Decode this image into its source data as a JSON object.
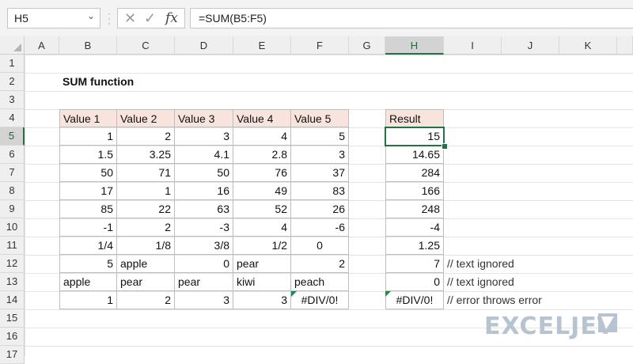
{
  "name_box": "H5",
  "formula": "=SUM(B5:F5)",
  "icons": {
    "cancel": "cancel-icon",
    "enter": "enter-icon",
    "function": "fx-icon",
    "dropdown": "chevron-down-icon"
  },
  "fx_label": "fx",
  "columns": [
    "A",
    "B",
    "C",
    "D",
    "E",
    "F",
    "G",
    "H",
    "I",
    "J",
    "K"
  ],
  "rows": [
    "1",
    "2",
    "3",
    "4",
    "5",
    "6",
    "7",
    "8",
    "9",
    "10",
    "11",
    "12",
    "13",
    "14",
    "15",
    "16",
    "17"
  ],
  "selected_column": "H",
  "selected_row": "5",
  "title": "SUM function",
  "table_headers": [
    "Value 1",
    "Value 2",
    "Value 3",
    "Value 4",
    "Value 5"
  ],
  "table_rows": [
    [
      "1",
      "2",
      "3",
      "4",
      "5"
    ],
    [
      "1.5",
      "3.25",
      "4.1",
      "2.8",
      "3"
    ],
    [
      "50",
      "71",
      "50",
      "76",
      "37"
    ],
    [
      "17",
      "1",
      "16",
      "49",
      "83"
    ],
    [
      "85",
      "22",
      "63",
      "52",
      "26"
    ],
    [
      "-1",
      "2",
      "-3",
      "4",
      "-6"
    ],
    [
      "1/4",
      "1/8",
      "3/8",
      "1/2",
      "0"
    ],
    [
      "5",
      "apple",
      "0",
      "pear",
      "2"
    ],
    [
      "apple",
      "pear",
      "pear",
      "kiwi",
      "peach"
    ],
    [
      "1",
      "2",
      "3",
      "3",
      "#DIV/0!"
    ]
  ],
  "result_header": "Result",
  "results": [
    "15",
    "14.65",
    "284",
    "166",
    "248",
    "-4",
    "1.25",
    "7",
    "0",
    "#DIV/0!"
  ],
  "notes": {
    "row12": "// text ignored",
    "row13": "// text ignored",
    "row14": "// error throws error"
  },
  "logo": "EXCELJET",
  "colors": {
    "accent": "#217346",
    "header_fill": "#f8e4dc",
    "error_flag": "#1e8a4c"
  }
}
